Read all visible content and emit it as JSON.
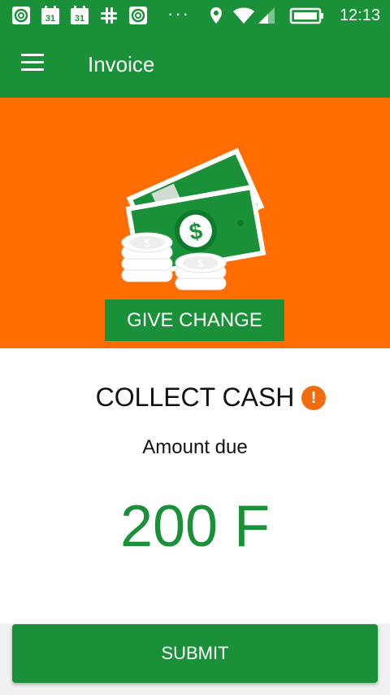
{
  "status_bar": {
    "time": "12:13",
    "calendar_day_1": "31",
    "calendar_day_2": "31",
    "more_dots": "···",
    "icons": [
      "app-logo-icon",
      "calendar-icon",
      "calendar-icon",
      "slack-icon",
      "app-logo-icon",
      "more-notifications-icon",
      "location-icon",
      "wifi-icon",
      "signal-icon",
      "battery-icon"
    ]
  },
  "app_bar": {
    "title": "Invoice",
    "menu_icon": "hamburger-menu-icon"
  },
  "hero": {
    "illustration": "cash-money-icon",
    "give_change_label": "GIVE CHANGE",
    "background_color": "#ff6d00"
  },
  "collect": {
    "title": "COLLECT CASH",
    "warning_icon": "warning-icon",
    "amount_label": "Amount due",
    "amount_value": "200 F"
  },
  "actions": {
    "submit_label": "SUBMIT"
  },
  "colors": {
    "primary": "#1a9139",
    "accent": "#ff6d00",
    "warning": "#f26c0d"
  }
}
